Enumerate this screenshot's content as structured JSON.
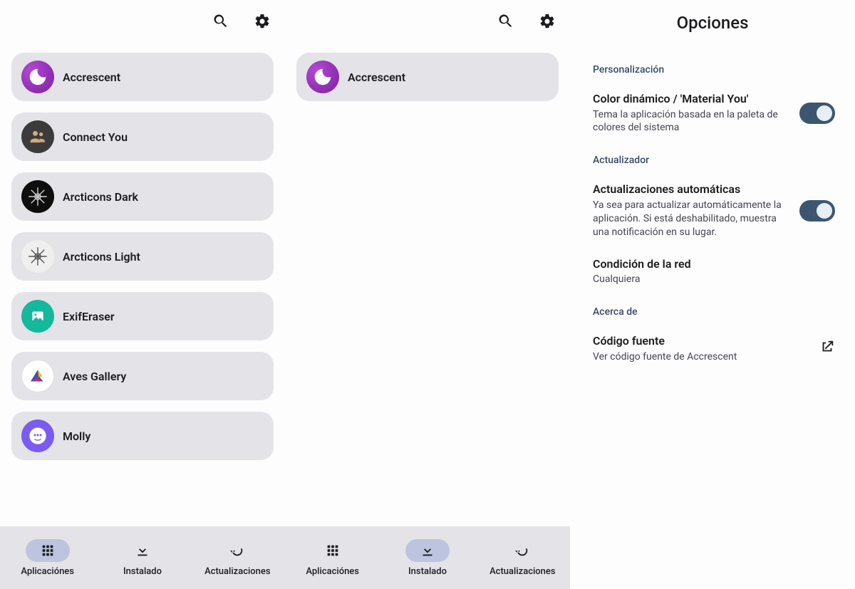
{
  "left": {
    "apps": [
      {
        "name": "Accrescent",
        "icon": "accrescent"
      },
      {
        "name": "Connect You",
        "icon": "connect"
      },
      {
        "name": "Arcticons Dark",
        "icon": "arcticons-dark"
      },
      {
        "name": "Arcticons Light",
        "icon": "arcticons-light"
      },
      {
        "name": "ExifEraser",
        "icon": "exif"
      },
      {
        "name": "Aves Gallery",
        "icon": "aves"
      },
      {
        "name": "Molly",
        "icon": "molly"
      }
    ],
    "nav": {
      "apps": "Aplicaciónes",
      "installed": "Instalado",
      "updates": "Actualizaciones",
      "active": "apps"
    }
  },
  "middle": {
    "apps": [
      {
        "name": "Accrescent",
        "icon": "accrescent"
      }
    ],
    "nav": {
      "apps": "Aplicaciónes",
      "installed": "Instalado",
      "updates": "Actualizaciones",
      "active": "installed"
    }
  },
  "right": {
    "title": "Opciones",
    "sections": {
      "personalization": {
        "header": "Personalización",
        "dynamic_color": {
          "title": "Color dinámico / 'Material You'",
          "sub": "Tema la aplicación basada en la paleta de colores del sistema",
          "enabled": true
        }
      },
      "updater": {
        "header": "Actualizador",
        "auto_updates": {
          "title": "Actualizaciones automáticas",
          "sub": "Ya sea para actualizar automáticamente la aplicación. Si está deshabilitado, muestra una notificación en su lugar.",
          "enabled": true
        },
        "network": {
          "title": "Condición de la red",
          "sub": "Cualquiera"
        }
      },
      "about": {
        "header": "Acerca de",
        "source": {
          "title": "Código fuente",
          "sub": "Ver código fuente de Accrescent"
        }
      }
    }
  }
}
